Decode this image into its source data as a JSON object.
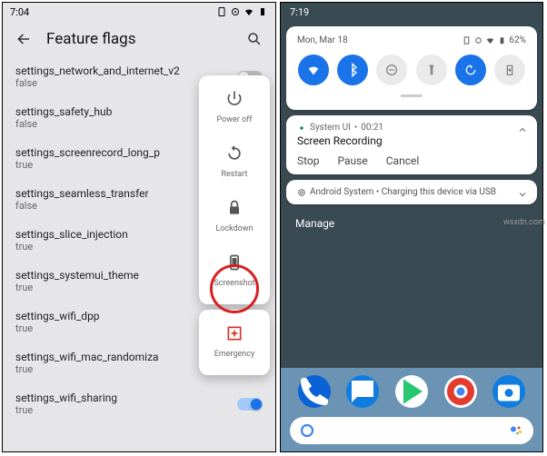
{
  "left": {
    "status_time": "7:04",
    "title": "Feature flags",
    "flags": [
      {
        "key": "settings_network_and_internet_v2",
        "value": "false",
        "toggle": "off"
      },
      {
        "key": "settings_safety_hub",
        "value": "false",
        "toggle": null
      },
      {
        "key": "settings_screenrecord_long_p",
        "value": "true",
        "toggle": null
      },
      {
        "key": "settings_seamless_transfer",
        "value": "false",
        "toggle": null
      },
      {
        "key": "settings_slice_injection",
        "value": "true",
        "toggle": null
      },
      {
        "key": "settings_systemui_theme",
        "value": "true",
        "toggle": null
      },
      {
        "key": "settings_wifi_dpp",
        "value": "true",
        "toggle": null
      },
      {
        "key": "settings_wifi_mac_randomiza",
        "value": "true",
        "toggle": null
      },
      {
        "key": "settings_wifi_sharing",
        "value": "true",
        "toggle": "on"
      }
    ],
    "power_menu": [
      {
        "label": "Power off",
        "icon": "power-icon"
      },
      {
        "label": "Restart",
        "icon": "restart-icon"
      },
      {
        "label": "Lockdown",
        "icon": "lock-icon"
      },
      {
        "label": "Screenshot",
        "icon": "screenshot-icon"
      }
    ],
    "emergency_label": "Emergency"
  },
  "right": {
    "status_time": "7:19",
    "date": "Mon, Mar 18",
    "battery": "62%",
    "qs": [
      {
        "name": "wifi",
        "state": "on"
      },
      {
        "name": "bluetooth",
        "state": "on"
      },
      {
        "name": "dnd",
        "state": "off"
      },
      {
        "name": "flashlight",
        "state": "off"
      },
      {
        "name": "rotate",
        "state": "on"
      },
      {
        "name": "battery-saver",
        "state": "off"
      }
    ],
    "notif1": {
      "app": "System UI",
      "time": "00:21",
      "title": "Screen Recording",
      "actions": [
        "Stop",
        "Pause",
        "Cancel"
      ]
    },
    "notif2": {
      "text": "Android System • Charging this device via USB"
    },
    "manage": "Manage"
  },
  "watermark": "wsxdn.com"
}
